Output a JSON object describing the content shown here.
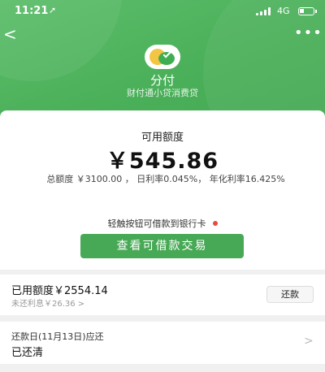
{
  "status_bar": {
    "time": "11:21",
    "location_icon": "location-arrow-icon",
    "network": "4G"
  },
  "header": {
    "back_icon": "back-chevron-icon",
    "more_icon": "more-dots-icon",
    "logo_icon": "fenfu-logo-icon",
    "title": "分付",
    "subtitle": "财付通小贷消费贷"
  },
  "credit": {
    "label": "可用额度",
    "amount": "￥545.86",
    "rate_info": "总额度 ￥3100.00 ， 日利率0.045%， 年化利率16.425%",
    "hint": "轻触按钮可借款到银行卡",
    "button_label": "查看可借款交易"
  },
  "used": {
    "amount_text": "已用额度￥2554.14",
    "unpaid_interest": "未还利息￥26.36 >",
    "repay_label": "还款"
  },
  "due": {
    "label": "还款日(11月13日)应还",
    "status": "已还清",
    "chevron": ">"
  },
  "colors": {
    "brand_green": "#47a955",
    "alert_red": "#e84b3c"
  }
}
